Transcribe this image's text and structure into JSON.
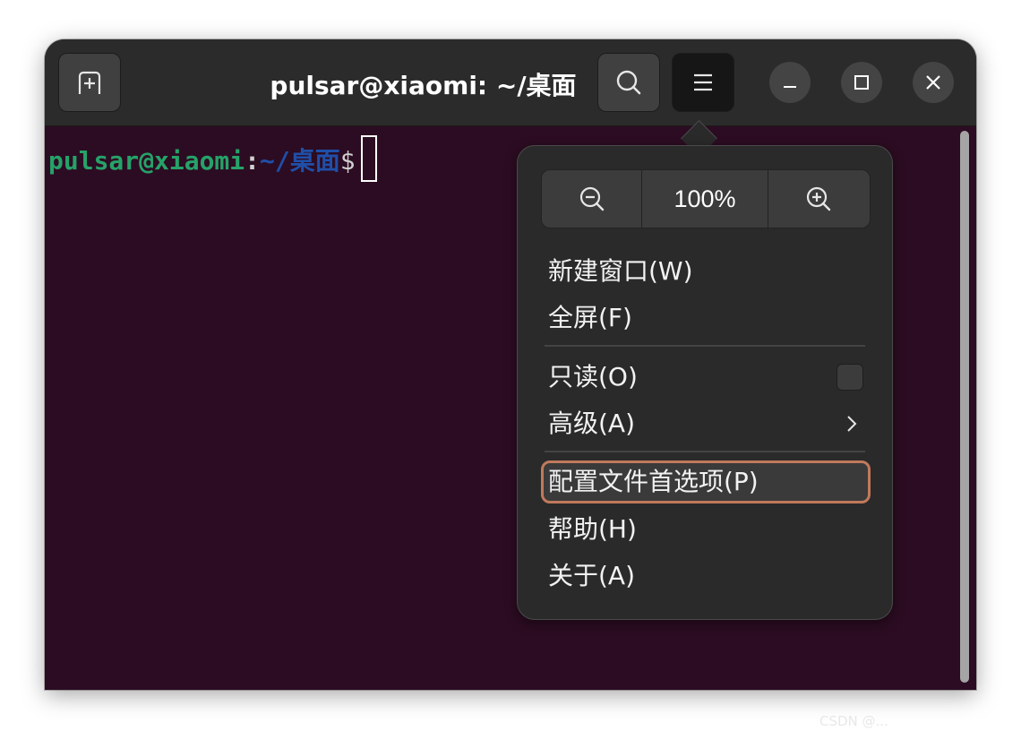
{
  "window": {
    "title": "pulsar@xiaomi: ~/桌面"
  },
  "titlebar": {
    "new_tab_icon": "new-tab-icon",
    "search_icon": "search-icon",
    "menu_icon": "hamburger-menu-icon",
    "minimize_icon": "minimize-icon",
    "maximize_icon": "maximize-icon",
    "close_icon": "close-icon"
  },
  "terminal": {
    "user_host": "pulsar@xiaomi",
    "colon": ":",
    "path": "~/桌面",
    "prompt_symbol": "$"
  },
  "menu": {
    "zoom": {
      "zoom_out_icon": "zoom-out-icon",
      "level": "100%",
      "zoom_in_icon": "zoom-in-icon"
    },
    "items": [
      {
        "label": "新建窗口(W)"
      },
      {
        "label": "全屏(F)"
      },
      {
        "label": "只读(O)",
        "checkbox": false
      },
      {
        "label": "高级(A)",
        "submenu": true
      },
      {
        "label": "配置文件首选项(P)",
        "focused": true
      },
      {
        "label": "帮助(H)"
      },
      {
        "label": "关于(A)"
      }
    ]
  },
  "colors": {
    "terminal_bg": "#2c0c22",
    "prompt_user": "#26a269",
    "prompt_path": "#1f4fa8",
    "focus_ring": "#c07a5c"
  },
  "watermark": "CSDN @..."
}
